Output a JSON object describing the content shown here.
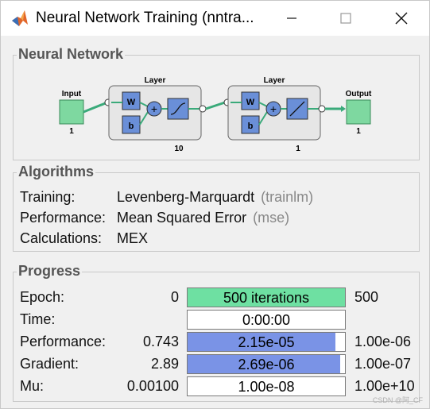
{
  "window": {
    "title": "Neural Network Training (nntra...",
    "minimize_icon": "minimize-icon",
    "maximize_icon": "maximize-icon",
    "close_icon": "close-icon"
  },
  "network": {
    "section_title": "Neural Network",
    "input_label": "Input",
    "input_size": "1",
    "layer1_label": "Layer",
    "layer1_size": "10",
    "layer2_label": "Layer",
    "layer2_size": "1",
    "output_label": "Output",
    "output_size": "1",
    "weight_label": "W",
    "bias_label": "b",
    "sum_symbol": "+"
  },
  "algorithms": {
    "section_title": "Algorithms",
    "rows": [
      {
        "label": "Training:",
        "value": "Levenberg-Marquardt",
        "paren": "(trainlm)"
      },
      {
        "label": "Performance:",
        "value": "Mean Squared Error",
        "paren": "(mse)"
      },
      {
        "label": "Calculations:",
        "value": "MEX",
        "paren": ""
      }
    ]
  },
  "progress": {
    "section_title": "Progress",
    "rows": [
      {
        "label": "Epoch:",
        "min": "0",
        "text": "500 iterations",
        "max": "500",
        "fill": 1.0,
        "color": "#6ee0a2"
      },
      {
        "label": "Time:",
        "min": "",
        "text": "0:00:00",
        "max": "",
        "fill": 0,
        "color": "#7a93e6"
      },
      {
        "label": "Performance:",
        "min": "0.743",
        "text": "2.15e-05",
        "max": "1.00e-06",
        "fill": 0.94,
        "color": "#7a93e6"
      },
      {
        "label": "Gradient:",
        "min": "2.89",
        "text": "2.69e-06",
        "max": "1.00e-07",
        "fill": 0.97,
        "color": "#7a93e6"
      },
      {
        "label": "Mu:",
        "min": "0.00100",
        "text": "1.00e-08",
        "max": "1.00e+10",
        "fill": 0,
        "color": "#7a93e6"
      }
    ]
  },
  "colors": {
    "node_green": "#7ed8a0",
    "node_blue": "#6a8fd8",
    "layer_box": "#e6e6e6"
  },
  "watermark": "CSDN @阿_CF"
}
